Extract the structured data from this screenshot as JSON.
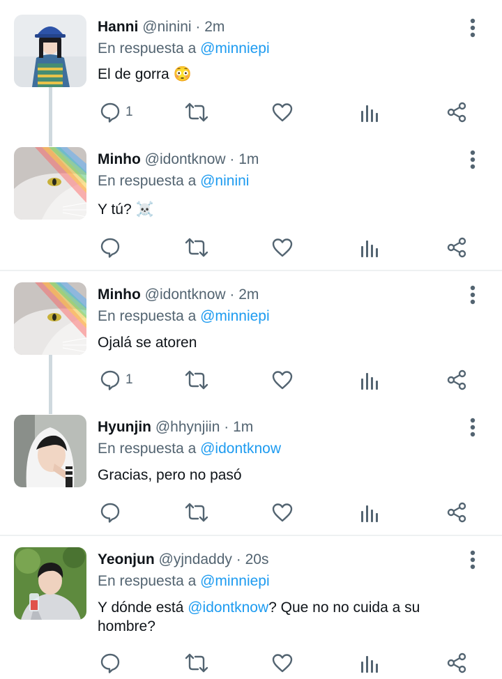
{
  "reply_prefix": "En respuesta a",
  "tweets": [
    {
      "name": "Hanni",
      "handle": "@ninini",
      "separator": "·",
      "time": "2m",
      "reply_to": "@minniepi",
      "text": "El de gorra 😳",
      "text_mention": "",
      "text_after": "",
      "replies": "1"
    },
    {
      "name": "Minho",
      "handle": "@idontknow",
      "separator": "·",
      "time": "1m",
      "reply_to": "@ninini",
      "text": "Y tú? ☠️",
      "text_mention": "",
      "text_after": "",
      "replies": ""
    },
    {
      "name": "Minho",
      "handle": "@idontknow",
      "separator": "·",
      "time": "2m",
      "reply_to": "@minniepi",
      "text": "Ojalá se atoren",
      "text_mention": "",
      "text_after": "",
      "replies": "1"
    },
    {
      "name": "Hyunjin",
      "handle": "@hhynjiin",
      "separator": "·",
      "time": "1m",
      "reply_to": "@idontknow",
      "text": "Gracias, pero no pasó",
      "text_mention": "",
      "text_after": "",
      "replies": ""
    },
    {
      "name": "Yeonjun",
      "handle": "@yjndaddy",
      "separator": "·",
      "time": "20s",
      "reply_to": "@minniepi",
      "text": "Y dónde está ",
      "text_mention": "@idontknow",
      "text_after": "? Que no no cuida a su hombre?",
      "replies": ""
    }
  ],
  "icons": {
    "reply": "reply-icon",
    "retweet": "retweet-icon",
    "like": "heart-icon",
    "views": "analytics-icon",
    "share": "share-icon",
    "more": "more-vertical-icon"
  },
  "colors": {
    "text": "#0f1419",
    "muted": "#536471",
    "accent": "#1d9bf0",
    "line": "#cfd9de"
  }
}
